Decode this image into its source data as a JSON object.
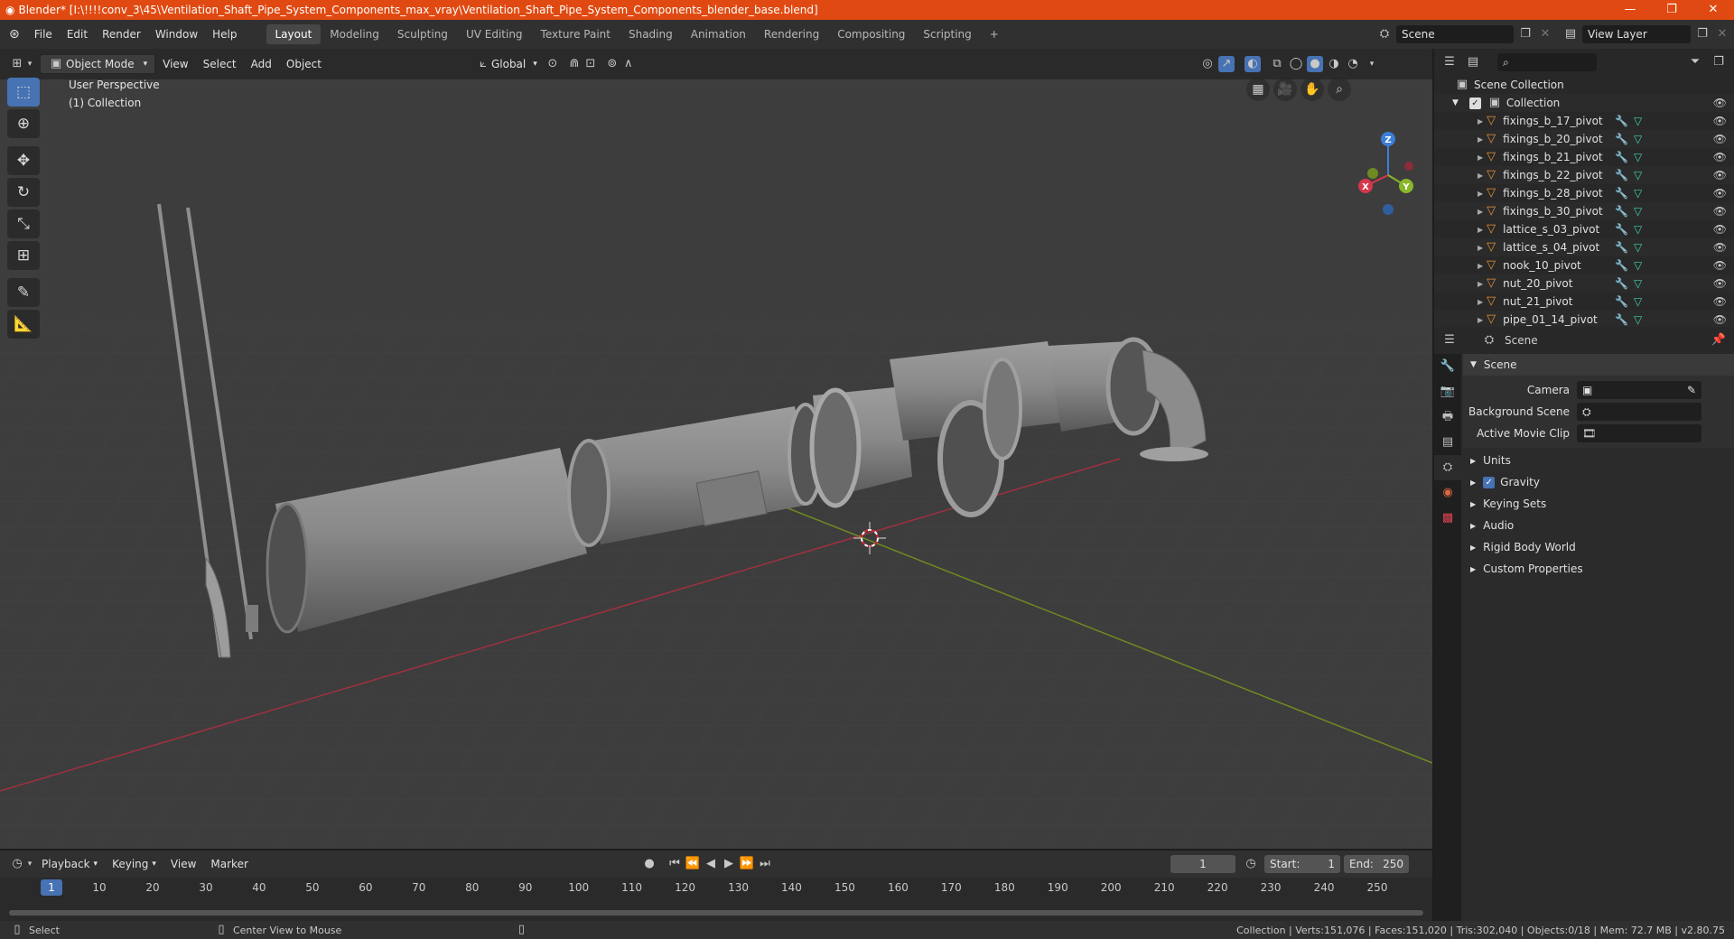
{
  "window": {
    "title": "Blender* [I:\\!!!!conv_3\\45\\Ventilation_Shaft_Pipe_System_Components_max_vray\\Ventilation_Shaft_Pipe_System_Components_blender_base.blend]",
    "minimize": "—",
    "maximize": "❐",
    "close": "✕"
  },
  "topbar": {
    "menus": [
      "File",
      "Edit",
      "Render",
      "Window",
      "Help"
    ],
    "workspaces": [
      "Layout",
      "Modeling",
      "Sculpting",
      "UV Editing",
      "Texture Paint",
      "Shading",
      "Animation",
      "Rendering",
      "Compositing",
      "Scripting"
    ],
    "active_workspace": "Layout",
    "add_tab": "+",
    "scene": "Scene",
    "view_layer": "View Layer"
  },
  "viewport_header": {
    "mode": "Object Mode",
    "menus": [
      "View",
      "Select",
      "Add",
      "Object"
    ],
    "orientation": "Global"
  },
  "viewport": {
    "perspective": "User Perspective",
    "collection": "(1) Collection",
    "gizmo": {
      "x": "X",
      "y": "Y",
      "z": "Z"
    }
  },
  "outliner": {
    "search_placeholder": "",
    "root": "Scene Collection",
    "collection": "Collection",
    "items": [
      {
        "name": "fixings_b_17_pivot",
        "mods": true
      },
      {
        "name": "fixings_b_20_pivot",
        "mods": true
      },
      {
        "name": "fixings_b_21_pivot",
        "mods": true
      },
      {
        "name": "fixings_b_22_pivot",
        "mods": true
      },
      {
        "name": "fixings_b_28_pivot",
        "mods": true
      },
      {
        "name": "fixings_b_30_pivot",
        "mods": true
      },
      {
        "name": "lattice_s_03_pivot",
        "mods": true
      },
      {
        "name": "lattice_s_04_pivot",
        "mods": true
      },
      {
        "name": "nook_10_pivot",
        "mods": true
      },
      {
        "name": "nut_20_pivot",
        "mods": true
      },
      {
        "name": "nut_21_pivot",
        "mods": true
      },
      {
        "name": "pipe_01_14_pivot",
        "mods": true
      }
    ]
  },
  "properties": {
    "header": "Scene",
    "section": "Scene",
    "camera_label": "Camera",
    "bg_scene_label": "Background Scene",
    "movie_clip_label": "Active Movie Clip",
    "panels": [
      "Units",
      "Gravity",
      "Keying Sets",
      "Audio",
      "Rigid Body World",
      "Custom Properties"
    ],
    "gravity_checked": "✓"
  },
  "timeline": {
    "menus": [
      "Playback",
      "Keying",
      "View",
      "Marker"
    ],
    "current_frame": "1",
    "start_label": "Start:",
    "start": "1",
    "end_label": "End:",
    "end": "250",
    "ticks": [
      "1",
      "10",
      "20",
      "30",
      "40",
      "50",
      "60",
      "70",
      "80",
      "90",
      "100",
      "110",
      "120",
      "130",
      "140",
      "150",
      "160",
      "170",
      "180",
      "190",
      "200",
      "210",
      "220",
      "230",
      "240",
      "250"
    ]
  },
  "statusbar": {
    "select": "Select",
    "center_view": "Center View to Mouse",
    "stats": "Collection | Verts:151,076 | Faces:151,020 | Tris:302,040 | Objects:0/18 | Mem: 72.7 MB | v2.80.75"
  },
  "colors": {
    "title_bar": "#e04a12",
    "accent": "#4772b3",
    "x_axis": "#d6374b",
    "y_axis": "#8ab62a",
    "z_axis": "#3d7ed8"
  }
}
